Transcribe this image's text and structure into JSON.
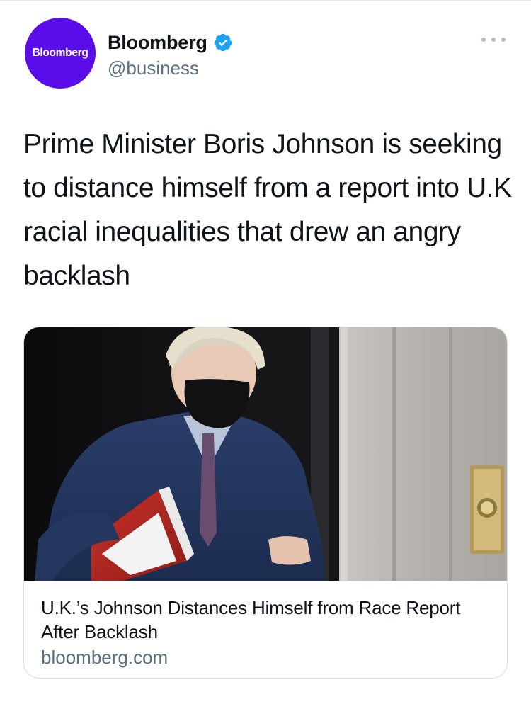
{
  "author": {
    "avatar_text": "Bloomberg",
    "avatar_color": "#5a0de8",
    "display_name": "Bloomberg",
    "verified": true,
    "verified_icon": "verified-badge-icon",
    "handle": "@business"
  },
  "menu": {
    "icon": "more-horizontal-icon"
  },
  "tweet": {
    "text": "Prime Minister Boris Johnson is seeking to distance himself from a report into U.K racial inequalities that drew an angry backlash"
  },
  "link_card": {
    "image_description_icon": "photo-image",
    "title": "U.K.’s Johnson Distances Himself from Race Report After Backlash",
    "domain": "bloomberg.com"
  },
  "colors": {
    "verified_blue": "#1da1f2",
    "secondary_text": "#5b7083",
    "primary_text": "#0f1419",
    "border": "#d9dde1"
  }
}
